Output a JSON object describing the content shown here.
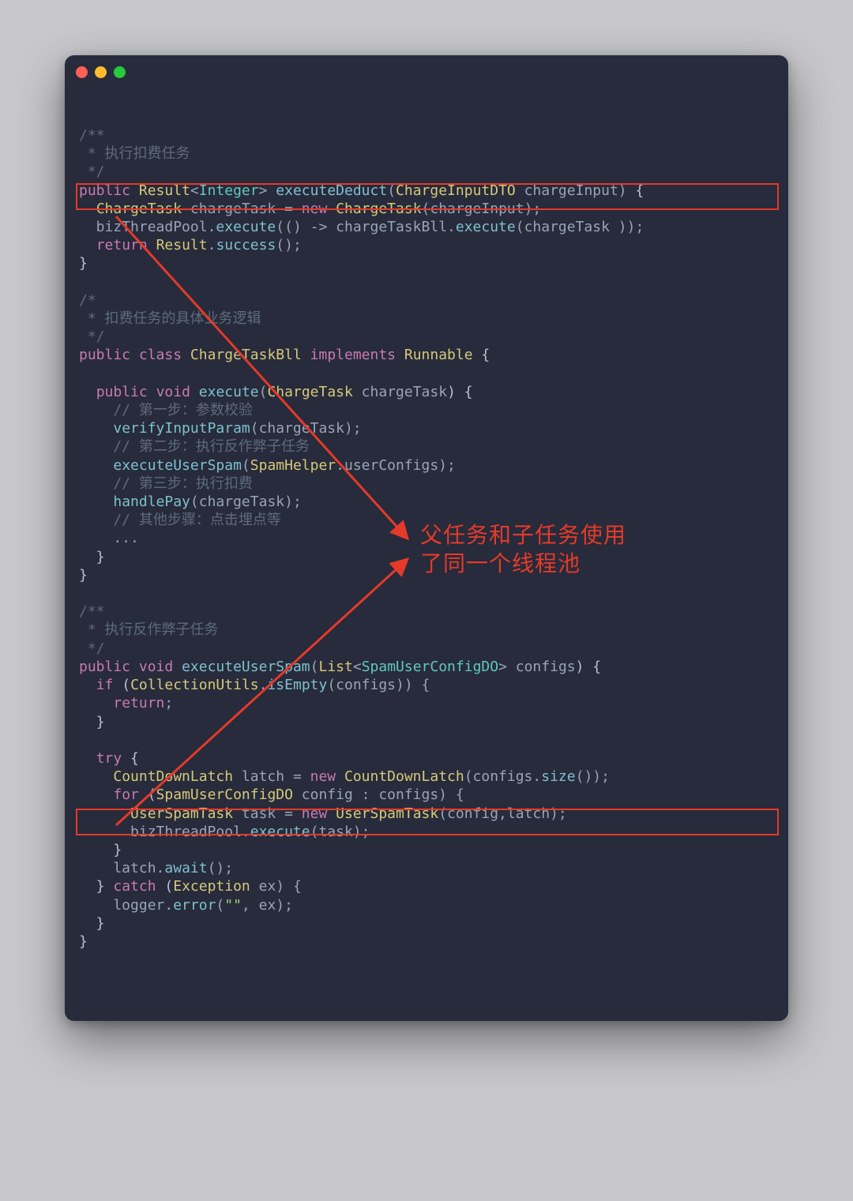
{
  "code": {
    "lines": [
      {
        "tokens": [
          {
            "t": "/**",
            "c": "c-comment"
          }
        ]
      },
      {
        "tokens": [
          {
            "t": " * 执行扣费任务",
            "c": "c-comment"
          }
        ]
      },
      {
        "tokens": [
          {
            "t": " */",
            "c": "c-comment"
          }
        ]
      },
      {
        "tokens": [
          {
            "t": "public",
            "c": "c-keyword"
          },
          {
            "t": " ",
            "c": "c-plain"
          },
          {
            "t": "Result",
            "c": "c-type"
          },
          {
            "t": "<",
            "c": "c-punct"
          },
          {
            "t": "Integer",
            "c": "c-typegen"
          },
          {
            "t": ">",
            "c": "c-punct"
          },
          {
            "t": " ",
            "c": "c-plain"
          },
          {
            "t": "executeDeduct",
            "c": "c-method"
          },
          {
            "t": "(",
            "c": "c-punct"
          },
          {
            "t": "ChargeInputDTO",
            "c": "c-type"
          },
          {
            "t": " chargeInput",
            "c": "c-var"
          },
          {
            "t": ")",
            "c": "c-punct"
          },
          {
            "t": " {",
            "c": "c-plain"
          }
        ]
      },
      {
        "tokens": [
          {
            "t": "  ",
            "c": "c-plain"
          },
          {
            "t": "ChargeTask",
            "c": "c-type"
          },
          {
            "t": " chargeTask ",
            "c": "c-var"
          },
          {
            "t": "=",
            "c": "c-punct"
          },
          {
            "t": " ",
            "c": "c-plain"
          },
          {
            "t": "new",
            "c": "c-new"
          },
          {
            "t": " ",
            "c": "c-plain"
          },
          {
            "t": "ChargeTask",
            "c": "c-type"
          },
          {
            "t": "(chargeInput);",
            "c": "c-var"
          }
        ]
      },
      {
        "tokens": [
          {
            "t": "  bizThreadPool",
            "c": "c-var"
          },
          {
            "t": ".",
            "c": "c-punct"
          },
          {
            "t": "execute",
            "c": "c-method"
          },
          {
            "t": "(() ",
            "c": "c-var"
          },
          {
            "t": "->",
            "c": "c-punct"
          },
          {
            "t": " chargeTaskBll",
            "c": "c-var"
          },
          {
            "t": ".",
            "c": "c-punct"
          },
          {
            "t": "execute",
            "c": "c-method"
          },
          {
            "t": "(chargeTask ));",
            "c": "c-var"
          }
        ]
      },
      {
        "tokens": [
          {
            "t": "  ",
            "c": "c-plain"
          },
          {
            "t": "return",
            "c": "c-keyword"
          },
          {
            "t": " ",
            "c": "c-plain"
          },
          {
            "t": "Result",
            "c": "c-type"
          },
          {
            "t": ".",
            "c": "c-punct"
          },
          {
            "t": "success",
            "c": "c-method"
          },
          {
            "t": "();",
            "c": "c-var"
          }
        ]
      },
      {
        "tokens": [
          {
            "t": "}",
            "c": "c-plain"
          }
        ]
      },
      {
        "tokens": [
          {
            "t": "",
            "c": "c-plain"
          }
        ]
      },
      {
        "tokens": [
          {
            "t": "/*",
            "c": "c-comment"
          }
        ]
      },
      {
        "tokens": [
          {
            "t": " * 扣费任务的具体业务逻辑",
            "c": "c-comment"
          }
        ]
      },
      {
        "tokens": [
          {
            "t": " */",
            "c": "c-comment"
          }
        ]
      },
      {
        "tokens": [
          {
            "t": "public",
            "c": "c-keyword"
          },
          {
            "t": " ",
            "c": "c-plain"
          },
          {
            "t": "class",
            "c": "c-keyword"
          },
          {
            "t": " ",
            "c": "c-plain"
          },
          {
            "t": "ChargeTaskBll",
            "c": "c-type"
          },
          {
            "t": " ",
            "c": "c-plain"
          },
          {
            "t": "implements",
            "c": "c-keyword"
          },
          {
            "t": " ",
            "c": "c-plain"
          },
          {
            "t": "Runnable",
            "c": "c-type"
          },
          {
            "t": " {",
            "c": "c-plain"
          }
        ]
      },
      {
        "tokens": [
          {
            "t": "",
            "c": "c-plain"
          }
        ]
      },
      {
        "tokens": [
          {
            "t": "  ",
            "c": "c-plain"
          },
          {
            "t": "public",
            "c": "c-keyword"
          },
          {
            "t": " ",
            "c": "c-plain"
          },
          {
            "t": "void",
            "c": "c-keyword"
          },
          {
            "t": " ",
            "c": "c-plain"
          },
          {
            "t": "execute",
            "c": "c-method"
          },
          {
            "t": "(",
            "c": "c-punct"
          },
          {
            "t": "ChargeTask",
            "c": "c-type"
          },
          {
            "t": " chargeTask",
            "c": "c-var"
          },
          {
            "t": ") {",
            "c": "c-plain"
          }
        ]
      },
      {
        "tokens": [
          {
            "t": "    // 第一步：参数校验",
            "c": "c-comment"
          }
        ]
      },
      {
        "tokens": [
          {
            "t": "    ",
            "c": "c-plain"
          },
          {
            "t": "verifyInputParam",
            "c": "c-method"
          },
          {
            "t": "(chargeTask);",
            "c": "c-var"
          }
        ]
      },
      {
        "tokens": [
          {
            "t": "    // 第二步：执行反作弊子任务",
            "c": "c-comment"
          }
        ]
      },
      {
        "tokens": [
          {
            "t": "    ",
            "c": "c-plain"
          },
          {
            "t": "executeUserSpam",
            "c": "c-method"
          },
          {
            "t": "(",
            "c": "c-var"
          },
          {
            "t": "SpamHelper",
            "c": "c-type"
          },
          {
            "t": ".userConfigs);",
            "c": "c-var"
          }
        ]
      },
      {
        "tokens": [
          {
            "t": "    // 第三步：执行扣费",
            "c": "c-comment"
          }
        ]
      },
      {
        "tokens": [
          {
            "t": "    ",
            "c": "c-plain"
          },
          {
            "t": "handlePay",
            "c": "c-method"
          },
          {
            "t": "(chargeTask);",
            "c": "c-var"
          }
        ]
      },
      {
        "tokens": [
          {
            "t": "    // 其他步骤：点击埋点等",
            "c": "c-comment"
          }
        ]
      },
      {
        "tokens": [
          {
            "t": "    ...",
            "c": "c-var"
          }
        ]
      },
      {
        "tokens": [
          {
            "t": "  }",
            "c": "c-plain"
          }
        ]
      },
      {
        "tokens": [
          {
            "t": "}",
            "c": "c-plain"
          }
        ]
      },
      {
        "tokens": [
          {
            "t": "",
            "c": "c-plain"
          }
        ]
      },
      {
        "tokens": [
          {
            "t": "/**",
            "c": "c-comment"
          }
        ]
      },
      {
        "tokens": [
          {
            "t": " * 执行反作弊子任务",
            "c": "c-comment"
          }
        ]
      },
      {
        "tokens": [
          {
            "t": " */",
            "c": "c-comment"
          }
        ]
      },
      {
        "tokens": [
          {
            "t": "public",
            "c": "c-keyword"
          },
          {
            "t": " ",
            "c": "c-plain"
          },
          {
            "t": "void",
            "c": "c-keyword"
          },
          {
            "t": " ",
            "c": "c-plain"
          },
          {
            "t": "executeUserSpam",
            "c": "c-method"
          },
          {
            "t": "(",
            "c": "c-punct"
          },
          {
            "t": "List",
            "c": "c-type"
          },
          {
            "t": "<",
            "c": "c-punct"
          },
          {
            "t": "SpamUserConfigDO",
            "c": "c-typegen"
          },
          {
            "t": ">",
            "c": "c-punct"
          },
          {
            "t": " configs",
            "c": "c-var"
          },
          {
            "t": ") {",
            "c": "c-plain"
          }
        ]
      },
      {
        "tokens": [
          {
            "t": "  ",
            "c": "c-plain"
          },
          {
            "t": "if",
            "c": "c-keyword"
          },
          {
            "t": " (",
            "c": "c-plain"
          },
          {
            "t": "CollectionUtils",
            "c": "c-type"
          },
          {
            "t": ".",
            "c": "c-punct"
          },
          {
            "t": "isEmpty",
            "c": "c-method"
          },
          {
            "t": "(configs)) {",
            "c": "c-var"
          }
        ]
      },
      {
        "tokens": [
          {
            "t": "    ",
            "c": "c-plain"
          },
          {
            "t": "return",
            "c": "c-keyword"
          },
          {
            "t": ";",
            "c": "c-punct"
          }
        ]
      },
      {
        "tokens": [
          {
            "t": "  }",
            "c": "c-plain"
          }
        ]
      },
      {
        "tokens": [
          {
            "t": "",
            "c": "c-plain"
          }
        ]
      },
      {
        "tokens": [
          {
            "t": "  ",
            "c": "c-plain"
          },
          {
            "t": "try",
            "c": "c-keyword"
          },
          {
            "t": " {",
            "c": "c-plain"
          }
        ]
      },
      {
        "tokens": [
          {
            "t": "    ",
            "c": "c-plain"
          },
          {
            "t": "CountDownLatch",
            "c": "c-type"
          },
          {
            "t": " latch ",
            "c": "c-var"
          },
          {
            "t": "=",
            "c": "c-punct"
          },
          {
            "t": " ",
            "c": "c-plain"
          },
          {
            "t": "new",
            "c": "c-new"
          },
          {
            "t": " ",
            "c": "c-plain"
          },
          {
            "t": "CountDownLatch",
            "c": "c-type"
          },
          {
            "t": "(configs.",
            "c": "c-var"
          },
          {
            "t": "size",
            "c": "c-method"
          },
          {
            "t": "());",
            "c": "c-var"
          }
        ]
      },
      {
        "tokens": [
          {
            "t": "    ",
            "c": "c-plain"
          },
          {
            "t": "for",
            "c": "c-keyword"
          },
          {
            "t": " (",
            "c": "c-plain"
          },
          {
            "t": "SpamUserConfigDO",
            "c": "c-type"
          },
          {
            "t": " config : configs) {",
            "c": "c-var"
          }
        ]
      },
      {
        "tokens": [
          {
            "t": "      ",
            "c": "c-plain"
          },
          {
            "t": "UserSpamTask",
            "c": "c-type"
          },
          {
            "t": " task ",
            "c": "c-var"
          },
          {
            "t": "=",
            "c": "c-punct"
          },
          {
            "t": " ",
            "c": "c-plain"
          },
          {
            "t": "new",
            "c": "c-new"
          },
          {
            "t": " ",
            "c": "c-plain"
          },
          {
            "t": "UserSpamTask",
            "c": "c-type"
          },
          {
            "t": "(config,latch);",
            "c": "c-var"
          }
        ]
      },
      {
        "tokens": [
          {
            "t": "      bizThreadPool",
            "c": "c-var"
          },
          {
            "t": ".",
            "c": "c-punct"
          },
          {
            "t": "execute",
            "c": "c-method"
          },
          {
            "t": "(task);",
            "c": "c-var"
          }
        ]
      },
      {
        "tokens": [
          {
            "t": "    }",
            "c": "c-plain"
          }
        ]
      },
      {
        "tokens": [
          {
            "t": "    latch",
            "c": "c-var"
          },
          {
            "t": ".",
            "c": "c-punct"
          },
          {
            "t": "await",
            "c": "c-method"
          },
          {
            "t": "();",
            "c": "c-var"
          }
        ]
      },
      {
        "tokens": [
          {
            "t": "  } ",
            "c": "c-plain"
          },
          {
            "t": "catch",
            "c": "c-keyword"
          },
          {
            "t": " (",
            "c": "c-plain"
          },
          {
            "t": "Exception",
            "c": "c-type"
          },
          {
            "t": " ex) {",
            "c": "c-var"
          }
        ]
      },
      {
        "tokens": [
          {
            "t": "    logger",
            "c": "c-var"
          },
          {
            "t": ".",
            "c": "c-punct"
          },
          {
            "t": "error",
            "c": "c-method"
          },
          {
            "t": "(",
            "c": "c-var"
          },
          {
            "t": "\"\"",
            "c": "c-string"
          },
          {
            "t": ", ex);",
            "c": "c-var"
          }
        ]
      },
      {
        "tokens": [
          {
            "t": "  }",
            "c": "c-plain"
          }
        ]
      },
      {
        "tokens": [
          {
            "t": "}",
            "c": "c-plain"
          }
        ]
      }
    ]
  },
  "annotation": {
    "line1": "父任务和子任务使用",
    "line2": "了同一个线程池"
  },
  "colors": {
    "highlight": "#e53a2a",
    "bg": "#272b3b",
    "page": "#c8c8cc"
  }
}
